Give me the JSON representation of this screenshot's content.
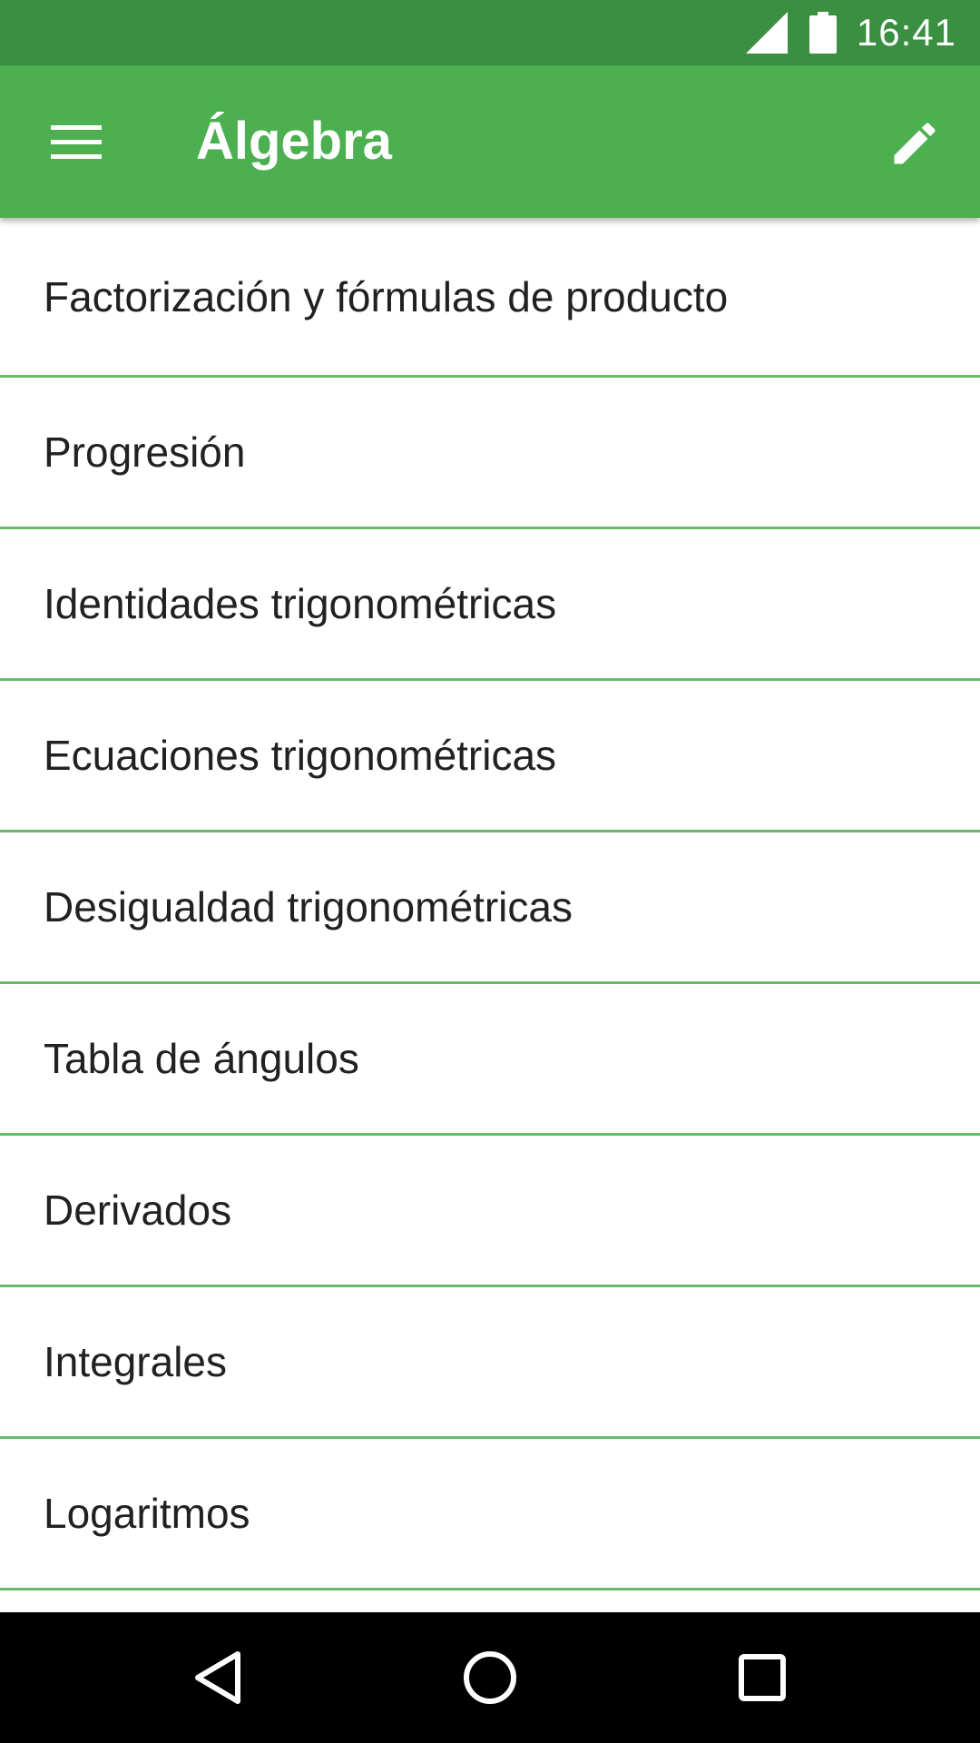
{
  "status_bar": {
    "time": "16:41",
    "icons": [
      "signal-icon",
      "battery-icon"
    ]
  },
  "app_bar": {
    "title": "Álgebra",
    "left_icon": "menu-icon",
    "right_icon": "edit-icon"
  },
  "list": {
    "items": [
      {
        "label": "Factorización y fórmulas de producto"
      },
      {
        "label": "Progresión"
      },
      {
        "label": "Identidades trigonométricas"
      },
      {
        "label": "Ecuaciones trigonométricas"
      },
      {
        "label": "Desigualdad trigonométricas"
      },
      {
        "label": "Tabla de ángulos"
      },
      {
        "label": "Derivados"
      },
      {
        "label": "Integrales"
      },
      {
        "label": "Logaritmos"
      }
    ]
  },
  "nav_bar": {
    "icons": [
      "back-icon",
      "home-icon",
      "recents-icon"
    ]
  },
  "colors": {
    "status_bar": "#3b8f41",
    "app_bar": "#4caf50",
    "divider": "#66bb6a",
    "text": "#212121",
    "nav_bar": "#000000"
  }
}
